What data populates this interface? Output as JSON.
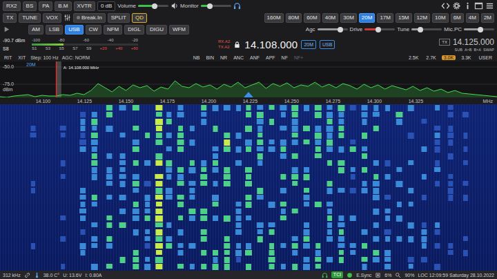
{
  "toolbar": {
    "buttons": [
      {
        "label": "RX2",
        "on": false
      },
      {
        "label": "BS",
        "on": false
      },
      {
        "label": "PA",
        "on": false
      },
      {
        "label": "B.M",
        "on": false
      },
      {
        "label": "XVTR",
        "on": false
      }
    ],
    "gain": "0 dB",
    "volume": {
      "label": "Volume",
      "level": 0.55
    },
    "monitor": {
      "label": "Monitor",
      "level": 0.3
    }
  },
  "tx_row": {
    "buttons": [
      {
        "label": "TX",
        "on": false
      },
      {
        "label": "TUNE",
        "on": false
      },
      {
        "label": "VOX",
        "on": false
      }
    ],
    "break_in": {
      "label": "Break.In",
      "on": false
    },
    "split": {
      "label": "SPLIT",
      "on": false
    },
    "qd": {
      "label": "QD",
      "on": true
    }
  },
  "bands": [
    {
      "label": "160M",
      "selected": false
    },
    {
      "label": "80M",
      "selected": false
    },
    {
      "label": "60M",
      "selected": false
    },
    {
      "label": "40M",
      "selected": false
    },
    {
      "label": "30M",
      "selected": false
    },
    {
      "label": "20M",
      "selected": true
    },
    {
      "label": "17M",
      "selected": false
    },
    {
      "label": "15M",
      "selected": false
    },
    {
      "label": "12M",
      "selected": false
    },
    {
      "label": "10M",
      "selected": false
    },
    {
      "label": "6M",
      "selected": false
    },
    {
      "label": "4M",
      "selected": false
    },
    {
      "label": "2M",
      "selected": false
    }
  ],
  "modes": [
    {
      "label": "AM",
      "selected": false
    },
    {
      "label": "LSB",
      "selected": false
    },
    {
      "label": "USB",
      "selected": true
    },
    {
      "label": "CW",
      "selected": false
    },
    {
      "label": "NFM",
      "selected": false
    },
    {
      "label": "DIGL",
      "selected": false
    },
    {
      "label": "DIGU",
      "selected": false
    },
    {
      "label": "WFM",
      "selected": false
    }
  ],
  "sliders": [
    {
      "label": "Agc",
      "level": 0.75,
      "color": "#9a9a9e"
    },
    {
      "label": "Drive",
      "level": 0.45,
      "color": "#d23a3a"
    },
    {
      "label": "Tune",
      "level": 0.3,
      "color": "#9a9a9e"
    },
    {
      "label": "Mic.PC",
      "level": 0.55,
      "color": "#9a9a9e"
    }
  ],
  "meter": {
    "reading": "-90.7 dBm",
    "dbm_scale": [
      "-100",
      "-80",
      "-60",
      "-40",
      "-20"
    ],
    "s_reading": "S8",
    "s_scale": [
      "S1",
      "S3",
      "S5",
      "S7",
      "S9",
      "+20",
      "+40",
      "+60"
    ],
    "level": 0.3
  },
  "vfo_a": {
    "rx": "RX.A2",
    "tx": "TX.A2",
    "frequency": "14.108.000",
    "locked": true,
    "band": "20M",
    "mode": "USB"
  },
  "vfo_b": {
    "tx": "TX",
    "frequency": "14.125.000",
    "buttons": [
      "SUB",
      "A>B",
      "B>A",
      "SWAP"
    ]
  },
  "rx_row": {
    "rit": "RIT",
    "xit": "XIT",
    "step": "Step: 100 Hz",
    "agc": "AGC: NORM"
  },
  "dsp": [
    {
      "label": "NB",
      "disabled": false
    },
    {
      "label": "BIN",
      "disabled": false
    },
    {
      "label": "NR",
      "disabled": false
    },
    {
      "label": "ANC",
      "disabled": false
    },
    {
      "label": "ANF",
      "disabled": false
    },
    {
      "label": "APF",
      "disabled": false
    },
    {
      "label": "NF",
      "disabled": false
    },
    {
      "label": "NF+",
      "disabled": true
    }
  ],
  "filters": [
    {
      "label": "2.5K",
      "selected": false
    },
    {
      "label": "2.7K",
      "selected": false
    },
    {
      "label": "3.0K",
      "selected": true
    },
    {
      "label": "3.3K",
      "selected": false
    },
    {
      "label": "USER",
      "selected": false
    }
  ],
  "spectrum": {
    "band": "20M",
    "marker": "A: 14.108.000 MHz",
    "y_ticks": [
      "-50.0",
      "-75.0"
    ],
    "unit": "dBm",
    "x_ticks": [
      "14.100",
      "14.125",
      "14.150",
      "14.175",
      "14.200",
      "14.225",
      "14.250",
      "14.275",
      "14.300",
      "14.325"
    ],
    "x_unit": "MHz",
    "values_dbm": [
      -93,
      -94,
      -92,
      -91,
      -90,
      -93,
      -91,
      -92,
      -92,
      -90,
      -91,
      -88,
      -90,
      -84,
      -74,
      -80,
      -86,
      -78,
      -84,
      -76,
      -80,
      -77,
      -85,
      -79,
      -82,
      -70,
      -78,
      -80,
      -74,
      -79,
      -76,
      -82,
      -75,
      -79,
      -72,
      -80,
      -76,
      -72,
      -81,
      -74,
      -78,
      -73,
      -80,
      -76,
      -78,
      -72,
      -79,
      -75,
      -80,
      -74,
      -77,
      -82,
      -75,
      -80,
      -76,
      -82,
      -77,
      -80,
      -83,
      -78,
      -84,
      -80,
      -85,
      -82,
      -87,
      -84,
      -88,
      -89,
      -90,
      -91,
      -92,
      -93
    ]
  },
  "waterfall": {
    "signals": [
      {
        "khz": 14094,
        "level": 0.2
      },
      {
        "khz": 14112,
        "level": 0.25
      },
      {
        "khz": 14124,
        "level": 0.45
      },
      {
        "khz": 14131,
        "level": 0.5
      },
      {
        "khz": 14140,
        "level": 0.55
      },
      {
        "khz": 14148,
        "level": 0.5
      },
      {
        "khz": 14156,
        "level": 0.6
      },
      {
        "khz": 14163,
        "level": 0.45
      },
      {
        "khz": 14170,
        "level": 0.9
      },
      {
        "khz": 14176,
        "level": 0.5
      },
      {
        "khz": 14183,
        "level": 0.55
      },
      {
        "khz": 14190,
        "level": 0.5
      },
      {
        "khz": 14197,
        "level": 0.6
      },
      {
        "khz": 14204,
        "level": 0.5
      },
      {
        "khz": 14211,
        "level": 0.65
      },
      {
        "khz": 14218,
        "level": 0.45
      },
      {
        "khz": 14224,
        "level": 0.6
      },
      {
        "khz": 14231,
        "level": 0.5
      },
      {
        "khz": 14238,
        "level": 0.55
      },
      {
        "khz": 14245,
        "level": 0.5
      },
      {
        "khz": 14252,
        "level": 0.6
      },
      {
        "khz": 14259,
        "level": 0.5
      },
      {
        "khz": 14266,
        "level": 0.55
      },
      {
        "khz": 14273,
        "level": 0.5
      },
      {
        "khz": 14280,
        "level": 0.6
      },
      {
        "khz": 14287,
        "level": 0.45
      },
      {
        "khz": 14294,
        "level": 0.5
      },
      {
        "khz": 14301,
        "level": 0.5
      },
      {
        "khz": 14308,
        "level": 0.45
      },
      {
        "khz": 14315,
        "level": 0.5
      },
      {
        "khz": 14322,
        "level": 0.4
      },
      {
        "khz": 14330,
        "level": 0.35
      },
      {
        "khz": 14338,
        "level": 0.3
      },
      {
        "khz": 14346,
        "level": 0.25
      },
      {
        "khz": 14355,
        "level": 0.2
      }
    ]
  },
  "status_bar": {
    "span": "312 kHz",
    "temperature": "38.0 C°",
    "voltage": "U: 13.6V",
    "current": "I: 0.80A",
    "tci": "TCI",
    "sync": "E.Sync",
    "cpu": "6%",
    "zoom": "90%",
    "clock": "LOC 12:09:59 Saturday 28.10.2022"
  }
}
